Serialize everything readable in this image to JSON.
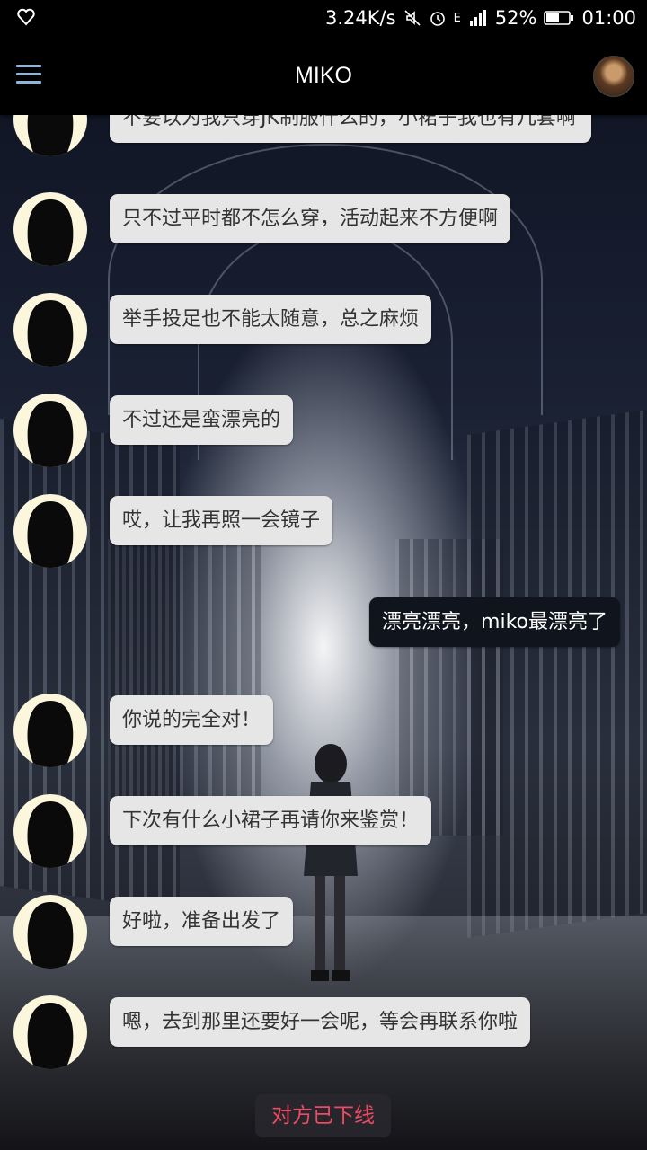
{
  "status_bar": {
    "speed": "3.24K/s",
    "network": "E",
    "battery": "52%",
    "time": "01:00"
  },
  "app_bar": {
    "title": "MIKO"
  },
  "messages": [
    {
      "from": "miko",
      "text": "不要以为我只穿JK制服什么的，小裙子我也有几套啊"
    },
    {
      "from": "miko",
      "text": "只不过平时都不怎么穿，活动起来不方便啊"
    },
    {
      "from": "miko",
      "text": "举手投足也不能太随意，总之麻烦"
    },
    {
      "from": "miko",
      "text": "不过还是蛮漂亮的"
    },
    {
      "from": "miko",
      "text": "哎，让我再照一会镜子"
    },
    {
      "from": "me",
      "text": "漂亮漂亮，miko最漂亮了"
    },
    {
      "from": "miko",
      "text": "你说的完全对！"
    },
    {
      "from": "miko",
      "text": "下次有什么小裙子再请你来鉴赏！"
    },
    {
      "from": "miko",
      "text": "好啦，准备出发了"
    },
    {
      "from": "miko",
      "text": "嗯，去到那里还要好一会呢，等会再联系你啦"
    }
  ],
  "footer": {
    "offline_notice": "对方已下线"
  },
  "icons": {
    "menu": "hamburger-menu-icon",
    "avatar": "miko-avatar",
    "profile": "user-profile-avatar"
  },
  "colors": {
    "bubble_in": "#e6e6e6",
    "bubble_out": "#10141c",
    "offline_text": "#ef4a63",
    "menu_icon": "#8fb3d9"
  }
}
